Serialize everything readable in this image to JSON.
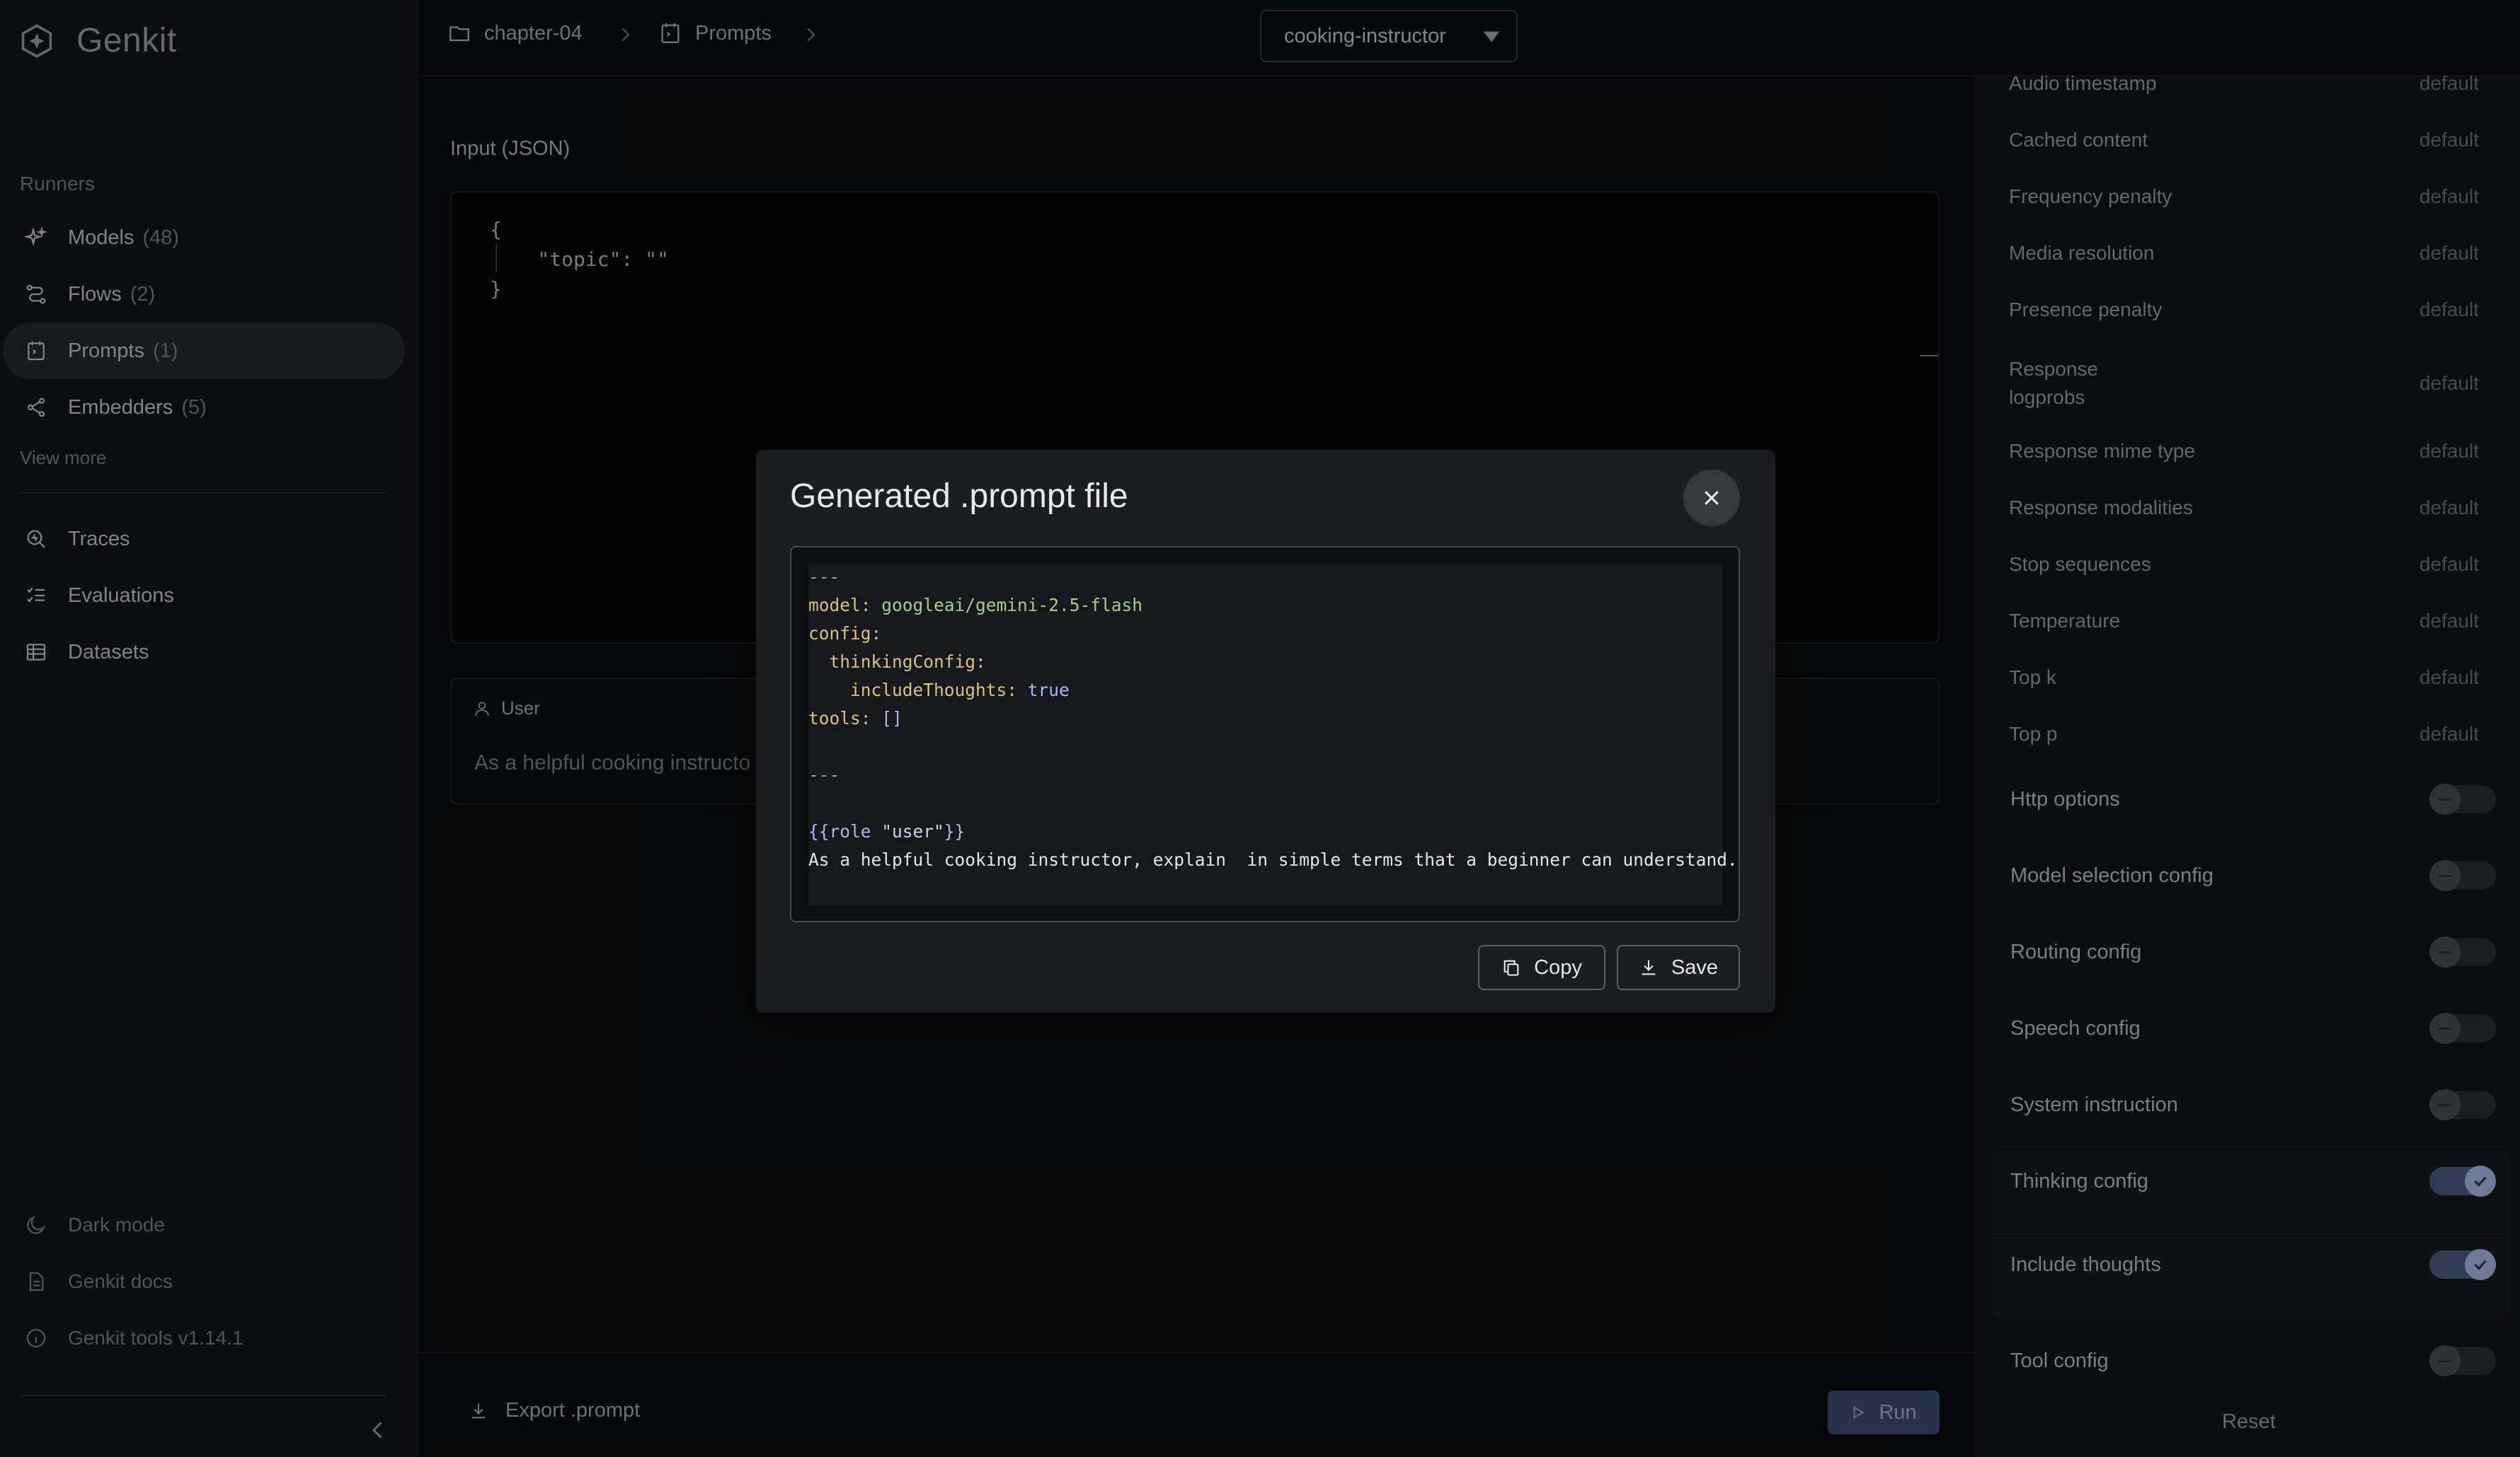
{
  "brand": {
    "name": "Genkit"
  },
  "sidebar": {
    "section_label": "Runners",
    "runners": [
      {
        "label": "Models",
        "count": "(48)",
        "icon": "sparkle-icon"
      },
      {
        "label": "Flows",
        "count": "(2)",
        "icon": "flow-icon"
      },
      {
        "label": "Prompts",
        "count": "(1)",
        "icon": "prompt-icon"
      },
      {
        "label": "Embedders",
        "count": "(5)",
        "icon": "embedder-icon"
      }
    ],
    "view_more": "View more",
    "tools": [
      {
        "label": "Traces",
        "icon": "search-trace-icon"
      },
      {
        "label": "Evaluations",
        "icon": "checklist-icon"
      },
      {
        "label": "Datasets",
        "icon": "table-icon"
      }
    ],
    "footer": [
      {
        "label": "Dark mode",
        "icon": "moon-icon"
      },
      {
        "label": "Genkit docs",
        "icon": "document-icon"
      },
      {
        "label": "Genkit tools v1.14.1",
        "icon": "info-icon"
      }
    ]
  },
  "breadcrumb": {
    "project": "chapter-04",
    "section": "Prompts",
    "selected_prompt": "cooking-instructor"
  },
  "main": {
    "input_label": "Input (JSON)",
    "input_json": "{\n    \"topic\": \"\"\n}",
    "message_role": "User",
    "message_preview": "As a helpful cooking instructo",
    "export_label": "Export .prompt",
    "run_label": "Run"
  },
  "config": {
    "rows": [
      {
        "label": "Audio timestamp",
        "value": "default"
      },
      {
        "label": "Cached content",
        "value": "default"
      },
      {
        "label": "Frequency penalty",
        "value": "default"
      },
      {
        "label": "Media resolution",
        "value": "default"
      },
      {
        "label": "Presence penalty",
        "value": "default"
      },
      {
        "label": "Response logprobs",
        "value": "default"
      },
      {
        "label": "Response mime type",
        "value": "default"
      },
      {
        "label": "Response modalities",
        "value": "default"
      },
      {
        "label": "Stop sequences",
        "value": "default"
      },
      {
        "label": "Temperature",
        "value": "default"
      },
      {
        "label": "Top k",
        "value": "default"
      },
      {
        "label": "Top p",
        "value": "default"
      }
    ],
    "toggles": [
      {
        "label": "Http options",
        "on": false
      },
      {
        "label": "Model selection config",
        "on": false
      },
      {
        "label": "Routing config",
        "on": false
      },
      {
        "label": "Speech config",
        "on": false
      },
      {
        "label": "System instruction",
        "on": false
      },
      {
        "label": "Thinking config",
        "on": true
      },
      {
        "label": "Include thoughts",
        "on": true
      },
      {
        "label": "Tool config",
        "on": false
      }
    ],
    "reset_label": "Reset"
  },
  "dialog": {
    "title": "Generated .prompt file",
    "code": {
      "dash_open": "---",
      "model_key": "model:",
      "model_value": "googleai/gemini-2.5-flash",
      "config_key": "config:",
      "thinking_key": "thinkingConfig:",
      "include_key": "includeThoughts:",
      "include_value": "true",
      "tools_key": "tools:",
      "tools_value": "[]",
      "dash_close": "---",
      "role_open": "{{role ",
      "role_value": "\"user\"",
      "role_close": "}}",
      "body": "As a helpful cooking instructor, explain  in simple terms that a beginner can understand."
    },
    "copy_label": "Copy",
    "save_label": "Save"
  }
}
